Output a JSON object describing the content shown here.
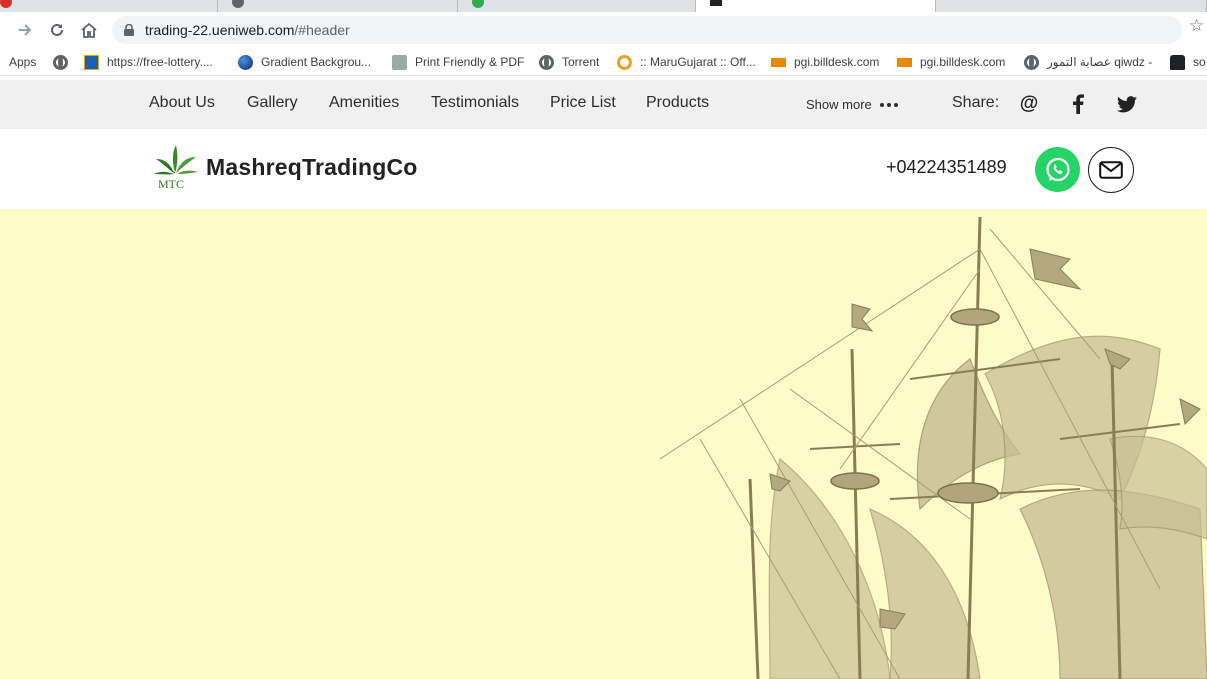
{
  "browser": {
    "url_host": "trading-22.ueniweb.com",
    "url_path": "/#header",
    "bookmarks": [
      {
        "label": "Apps",
        "icon": "apps-icon"
      },
      {
        "label": "",
        "icon": "globe-icon"
      },
      {
        "label": "https://free-lottery....",
        "icon": "lottery-favicon"
      },
      {
        "label": "Gradient Backgrou...",
        "icon": "gradient-favicon"
      },
      {
        "label": "Print Friendly & PDF",
        "icon": "printer-favicon"
      },
      {
        "label": "Torrent",
        "icon": "globe-icon"
      },
      {
        "label": ":: MaruGujarat :: Off...",
        "icon": "marugujarat-favicon"
      },
      {
        "label": "pgi.billdesk.com",
        "icon": "billdesk-favicon"
      },
      {
        "label": "pgi.billdesk.com",
        "icon": "billdesk-favicon"
      },
      {
        "label": "عصابة التمور qiwdz -",
        "icon": "globe-icon"
      },
      {
        "label": "so",
        "icon": "car-favicon"
      }
    ]
  },
  "site_nav": {
    "links": [
      "About Us",
      "Gallery",
      "Amenities",
      "Testimonials",
      "Price List",
      "Products"
    ],
    "show_more": "Show more",
    "share_label": "Share:"
  },
  "header": {
    "logo_text": "MTC",
    "brand": "MashreqTradingCo",
    "phone": "+04224351489"
  },
  "colors": {
    "hero_bg": "#fdfcc9",
    "whatsapp": "#25d366",
    "nav_bg": "#f0f0f0",
    "logo_green": "#3a8a2a",
    "ship": "#bdb38a"
  }
}
